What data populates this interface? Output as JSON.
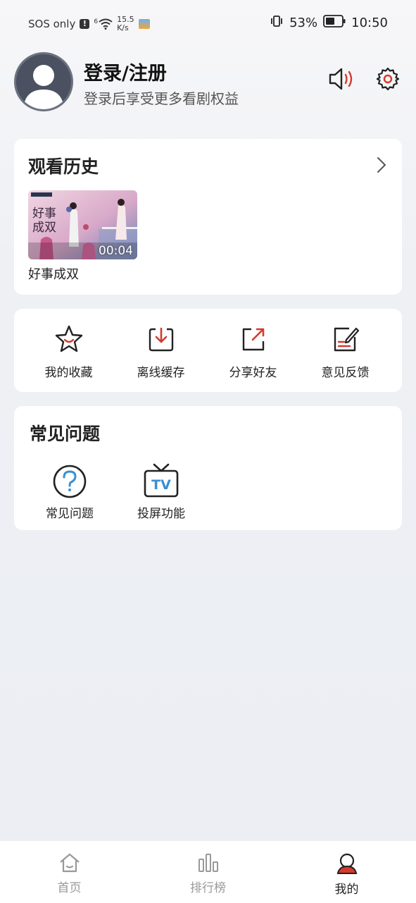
{
  "status_bar": {
    "carrier": "SOS only",
    "network_gen": "6",
    "speed_value": "15.5",
    "speed_unit": "K/s",
    "battery": "53%",
    "time": "10:50"
  },
  "header": {
    "login_title": "登录/注册",
    "login_subtitle": "登录后享受更多看剧权益"
  },
  "history": {
    "title": "观看历史",
    "items": [
      {
        "title": "好事成双",
        "duration": "00:04"
      }
    ]
  },
  "actions": [
    {
      "label": "我的收藏",
      "icon": "star-icon"
    },
    {
      "label": "离线缓存",
      "icon": "download-icon"
    },
    {
      "label": "分享好友",
      "icon": "share-icon"
    },
    {
      "label": "意见反馈",
      "icon": "feedback-icon"
    }
  ],
  "faq": {
    "title": "常见问题",
    "items": [
      {
        "label": "常见问题",
        "icon": "question-icon"
      },
      {
        "label": "投屏功能",
        "icon": "tv-icon"
      }
    ]
  },
  "bottom_nav": [
    {
      "label": "首页",
      "icon": "home-icon",
      "active": false
    },
    {
      "label": "排行榜",
      "icon": "ranking-icon",
      "active": false
    },
    {
      "label": "我的",
      "icon": "profile-icon",
      "active": true
    }
  ],
  "colors": {
    "accent_red": "#d33a2c",
    "faq_blue": "#3a8fd0",
    "nav_inactive": "#999999"
  }
}
